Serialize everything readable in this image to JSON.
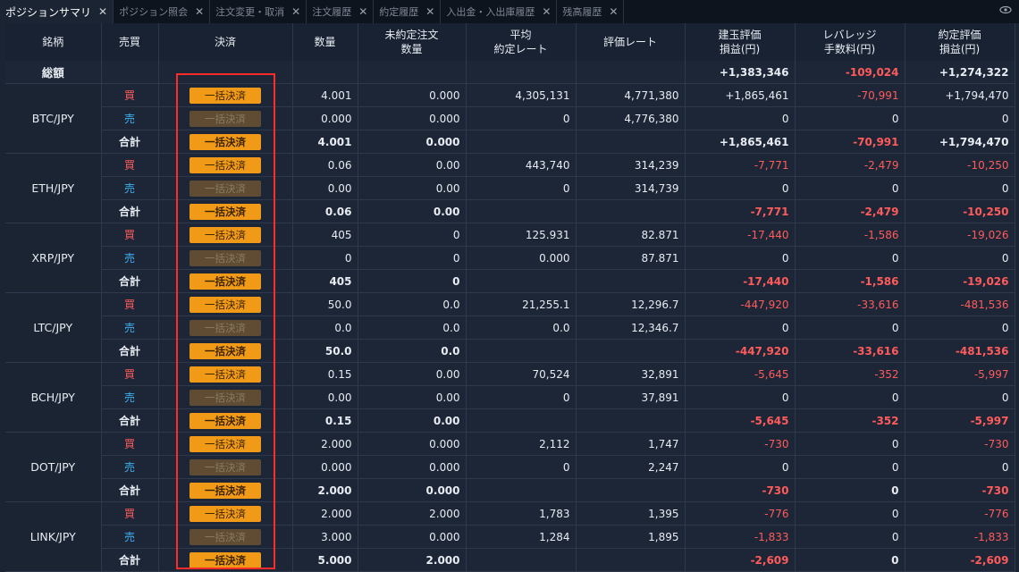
{
  "tabs": [
    {
      "label": "ポジションサマリ",
      "active": true
    },
    {
      "label": "ポジション照会",
      "active": false
    },
    {
      "label": "注文変更・取消",
      "active": false
    },
    {
      "label": "注文履歴",
      "active": false
    },
    {
      "label": "約定履歴",
      "active": false
    },
    {
      "label": "入出金・入出庫履歴",
      "active": false
    },
    {
      "label": "残高履歴",
      "active": false
    }
  ],
  "close_glyph": "✕",
  "header": {
    "symbol": "銘柄",
    "side": "売買",
    "settle": "決済",
    "qty": "数量",
    "unfilled_l1": "未約定注文",
    "unfilled_l2": "数量",
    "avg_l1": "平均",
    "avg_l2": "約定レート",
    "eval": "評価レート",
    "pl_l1": "建玉評価",
    "pl_l2": "損益(円)",
    "fee_l1": "レバレッジ",
    "fee_l2": "手数料(円)",
    "settled_l1": "約定評価",
    "settled_l2": "損益(円)"
  },
  "total_row": {
    "label": "総額",
    "pl": "+1,383,346",
    "fee": "-109,024",
    "settled": "+1,274,322"
  },
  "button_label": "一括決済",
  "side_labels": {
    "buy": "買",
    "sell": "売",
    "total": "合計"
  },
  "groups": [
    {
      "symbol": "BTC/JPY",
      "rows": [
        {
          "side": "buy",
          "qty": "4.001",
          "unfilled": "0.000",
          "avg": "4,305,131",
          "eval": "4,771,380",
          "pl": "+1,865,461",
          "fee": "-70,991",
          "settled": "+1,794,470"
        },
        {
          "side": "sell",
          "qty": "0.000",
          "unfilled": "0.000",
          "avg": "0",
          "eval": "4,776,380",
          "pl": "0",
          "fee": "0",
          "settled": "0"
        },
        {
          "side": "total",
          "qty": "4.001",
          "unfilled": "0.000",
          "avg": "",
          "eval": "",
          "pl": "+1,865,461",
          "fee": "-70,991",
          "settled": "+1,794,470"
        }
      ]
    },
    {
      "symbol": "ETH/JPY",
      "rows": [
        {
          "side": "buy",
          "qty": "0.06",
          "unfilled": "0.00",
          "avg": "443,740",
          "eval": "314,239",
          "pl": "-7,771",
          "fee": "-2,479",
          "settled": "-10,250"
        },
        {
          "side": "sell",
          "qty": "0.00",
          "unfilled": "0.00",
          "avg": "0",
          "eval": "314,739",
          "pl": "0",
          "fee": "0",
          "settled": "0"
        },
        {
          "side": "total",
          "qty": "0.06",
          "unfilled": "0.00",
          "avg": "",
          "eval": "",
          "pl": "-7,771",
          "fee": "-2,479",
          "settled": "-10,250"
        }
      ]
    },
    {
      "symbol": "XRP/JPY",
      "rows": [
        {
          "side": "buy",
          "qty": "405",
          "unfilled": "0",
          "avg": "125.931",
          "eval": "82.871",
          "pl": "-17,440",
          "fee": "-1,586",
          "settled": "-19,026"
        },
        {
          "side": "sell",
          "qty": "0",
          "unfilled": "0",
          "avg": "0.000",
          "eval": "87.871",
          "pl": "0",
          "fee": "0",
          "settled": "0"
        },
        {
          "side": "total",
          "qty": "405",
          "unfilled": "0",
          "avg": "",
          "eval": "",
          "pl": "-17,440",
          "fee": "-1,586",
          "settled": "-19,026"
        }
      ]
    },
    {
      "symbol": "LTC/JPY",
      "rows": [
        {
          "side": "buy",
          "qty": "50.0",
          "unfilled": "0.0",
          "avg": "21,255.1",
          "eval": "12,296.7",
          "pl": "-447,920",
          "fee": "-33,616",
          "settled": "-481,536"
        },
        {
          "side": "sell",
          "qty": "0.0",
          "unfilled": "0.0",
          "avg": "0.0",
          "eval": "12,346.7",
          "pl": "0",
          "fee": "0",
          "settled": "0"
        },
        {
          "side": "total",
          "qty": "50.0",
          "unfilled": "0.0",
          "avg": "",
          "eval": "",
          "pl": "-447,920",
          "fee": "-33,616",
          "settled": "-481,536"
        }
      ]
    },
    {
      "symbol": "BCH/JPY",
      "rows": [
        {
          "side": "buy",
          "qty": "0.15",
          "unfilled": "0.00",
          "avg": "70,524",
          "eval": "32,891",
          "pl": "-5,645",
          "fee": "-352",
          "settled": "-5,997"
        },
        {
          "side": "sell",
          "qty": "0.00",
          "unfilled": "0.00",
          "avg": "0",
          "eval": "37,891",
          "pl": "0",
          "fee": "0",
          "settled": "0"
        },
        {
          "side": "total",
          "qty": "0.15",
          "unfilled": "0.00",
          "avg": "",
          "eval": "",
          "pl": "-5,645",
          "fee": "-352",
          "settled": "-5,997"
        }
      ]
    },
    {
      "symbol": "DOT/JPY",
      "rows": [
        {
          "side": "buy",
          "qty": "2.000",
          "unfilled": "0.000",
          "avg": "2,112",
          "eval": "1,747",
          "pl": "-730",
          "fee": "0",
          "settled": "-730"
        },
        {
          "side": "sell",
          "qty": "0.000",
          "unfilled": "0.000",
          "avg": "0",
          "eval": "2,247",
          "pl": "0",
          "fee": "0",
          "settled": "0"
        },
        {
          "side": "total",
          "qty": "2.000",
          "unfilled": "0.000",
          "avg": "",
          "eval": "",
          "pl": "-730",
          "fee": "0",
          "settled": "-730"
        }
      ]
    },
    {
      "symbol": "LINK/JPY",
      "rows": [
        {
          "side": "buy",
          "qty": "2.000",
          "unfilled": "2.000",
          "avg": "1,783",
          "eval": "1,395",
          "pl": "-776",
          "fee": "0",
          "settled": "-776"
        },
        {
          "side": "sell",
          "qty": "3.000",
          "unfilled": "0.000",
          "avg": "1,284",
          "eval": "1,895",
          "pl": "-1,833",
          "fee": "0",
          "settled": "-1,833"
        },
        {
          "side": "total",
          "qty": "5.000",
          "unfilled": "2.000",
          "avg": "",
          "eval": "",
          "pl": "-2,609",
          "fee": "0",
          "settled": "-2,609"
        }
      ]
    }
  ],
  "colors": {
    "buy": "#ff5b5b",
    "sell": "#3fb0f0",
    "button_active": "#f19a17",
    "button_disabled": "#5f4c33",
    "highlight": "#ff2b2b"
  }
}
